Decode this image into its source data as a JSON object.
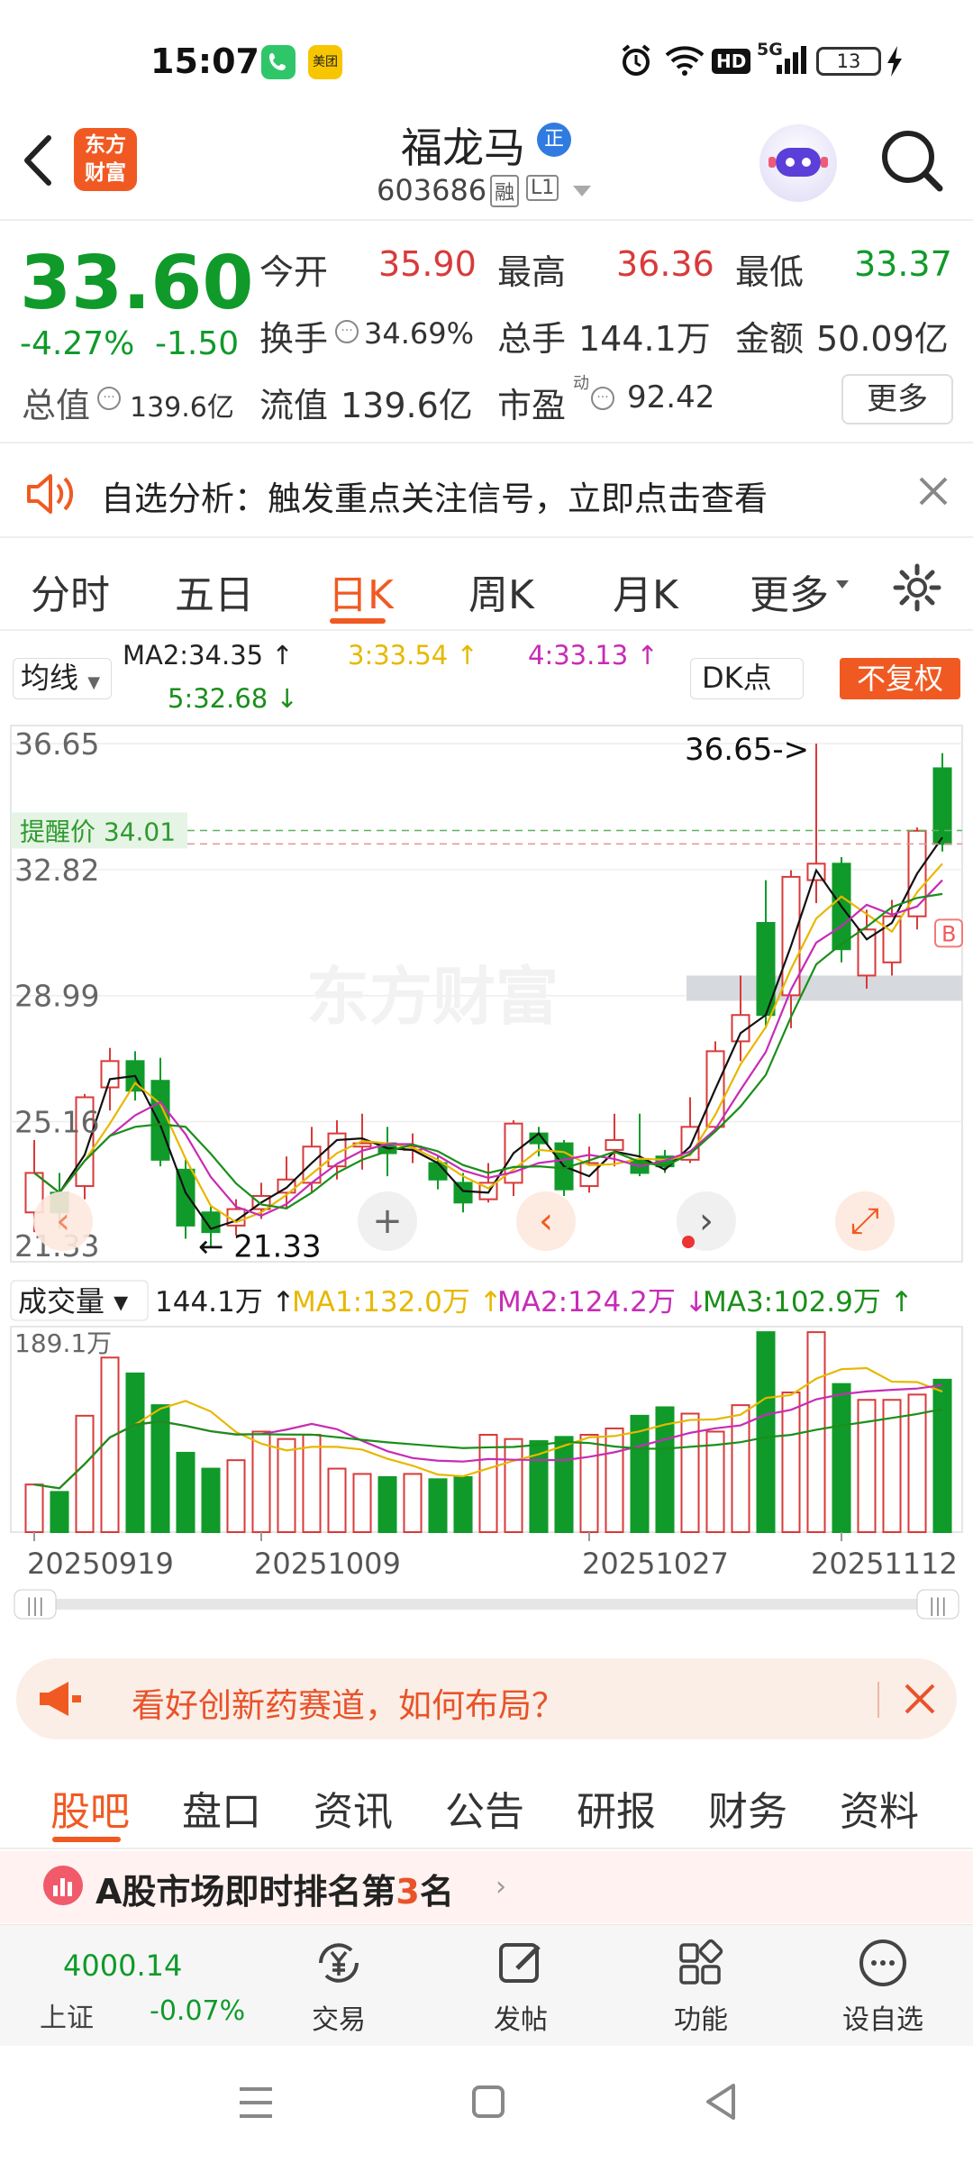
{
  "status_bar": {
    "time": "15:07",
    "app2_label": "美团",
    "network": "5G",
    "battery": "13",
    "hd": "HD"
  },
  "header": {
    "logo_line1": "东方",
    "logo_line2": "财富",
    "stock_name": "福龙马",
    "badge": "正",
    "code": "603686",
    "tag_margin": "融",
    "tag_level": "L1"
  },
  "quote": {
    "price": "33.60",
    "change_pct": "-4.27%",
    "change": "-1.50",
    "open_label": "今开",
    "open": "35.90",
    "high_label": "最高",
    "high": "36.36",
    "low_label": "最低",
    "low": "33.37",
    "turnover_label": "换手",
    "turnover": "34.69%",
    "volume_label": "总手",
    "volume": "144.1万",
    "amount_label": "金额",
    "amount": "50.09亿",
    "mktcap_label": "总值",
    "mktcap": "139.6亿",
    "float_label": "流值",
    "float": "139.6亿",
    "pe_label": "市盈",
    "pe_sup": "动",
    "pe": "92.42",
    "more_button": "更多"
  },
  "notice": {
    "text": "自选分析：触发重点关注信号，立即点击查看"
  },
  "chart_tabs": [
    "分时",
    "五日",
    "日K",
    "周K",
    "月K",
    "更多"
  ],
  "active_tab": "日K",
  "chart_controls": {
    "ma_select": "均线",
    "ma2": "MA2:34.35",
    "ma3": "3:33.54",
    "ma4": "4:33.13",
    "ma5": "5:32.68",
    "dk_button": "DK点",
    "adjust_button": "不复权",
    "alert_price": "提醒价 34.01",
    "high_marker": "36.65->",
    "low_marker": "21.33",
    "watermark": "东方财富",
    "b_marker": "B"
  },
  "chart_data": {
    "type": "candlestick",
    "y_ticks": [
      "36.65",
      "32.82",
      "28.99",
      "25.16",
      "21.33"
    ],
    "ylim": [
      21.33,
      36.65
    ],
    "x_labels": [
      "20250919",
      "20251009",
      "20251027",
      "20251112"
    ],
    "candles": [
      {
        "o": 22.4,
        "c": 23.6,
        "h": 24.6,
        "l": 21.8
      },
      {
        "o": 23.0,
        "c": 22.4,
        "h": 23.6,
        "l": 21.9
      },
      {
        "o": 23.2,
        "c": 25.9,
        "h": 26.0,
        "l": 22.8
      },
      {
        "o": 26.2,
        "c": 27.0,
        "h": 27.4,
        "l": 25.5
      },
      {
        "o": 27.0,
        "c": 26.1,
        "h": 27.3,
        "l": 25.8
      },
      {
        "o": 26.4,
        "c": 24.0,
        "h": 27.1,
        "l": 23.8
      },
      {
        "o": 23.7,
        "c": 22.0,
        "h": 24.0,
        "l": 21.6
      },
      {
        "o": 22.4,
        "c": 21.8,
        "h": 22.6,
        "l": 21.33
      },
      {
        "o": 22.0,
        "c": 22.5,
        "h": 22.8,
        "l": 21.7
      },
      {
        "o": 22.5,
        "c": 22.9,
        "h": 23.3,
        "l": 22.2
      },
      {
        "o": 23.0,
        "c": 23.4,
        "h": 24.1,
        "l": 22.5
      },
      {
        "o": 23.3,
        "c": 24.4,
        "h": 25.0,
        "l": 23.0
      },
      {
        "o": 23.8,
        "c": 24.8,
        "h": 25.2,
        "l": 23.4
      },
      {
        "o": 24.4,
        "c": 24.5,
        "h": 25.4,
        "l": 23.7
      },
      {
        "o": 24.5,
        "c": 24.2,
        "h": 25.0,
        "l": 23.5
      },
      {
        "o": 24.3,
        "c": 24.4,
        "h": 24.8,
        "l": 23.9
      },
      {
        "o": 23.9,
        "c": 23.4,
        "h": 24.1,
        "l": 23.1
      },
      {
        "o": 23.3,
        "c": 22.7,
        "h": 23.6,
        "l": 22.4
      },
      {
        "o": 22.8,
        "c": 23.3,
        "h": 23.9,
        "l": 22.7
      },
      {
        "o": 23.3,
        "c": 25.1,
        "h": 25.2,
        "l": 22.9
      },
      {
        "o": 24.8,
        "c": 24.5,
        "h": 25.0,
        "l": 24.1
      },
      {
        "o": 24.5,
        "c": 23.1,
        "h": 24.6,
        "l": 22.9
      },
      {
        "o": 23.2,
        "c": 23.9,
        "h": 24.4,
        "l": 23.0
      },
      {
        "o": 24.3,
        "c": 24.6,
        "h": 25.4,
        "l": 23.8
      },
      {
        "o": 24.0,
        "c": 23.6,
        "h": 25.4,
        "l": 23.5
      },
      {
        "o": 24.1,
        "c": 23.8,
        "h": 24.3,
        "l": 23.6
      },
      {
        "o": 24.0,
        "c": 25.0,
        "h": 25.9,
        "l": 23.9
      },
      {
        "o": 25.0,
        "c": 27.3,
        "h": 27.6,
        "l": 24.9
      },
      {
        "o": 27.6,
        "c": 28.4,
        "h": 29.6,
        "l": 27.0
      },
      {
        "o": 31.2,
        "c": 28.4,
        "h": 32.5,
        "l": 28.0
      },
      {
        "o": 29.0,
        "c": 32.6,
        "h": 32.8,
        "l": 28.0
      },
      {
        "o": 32.5,
        "c": 33.0,
        "h": 36.65,
        "l": 31.8
      },
      {
        "o": 33.0,
        "c": 30.4,
        "h": 33.2,
        "l": 30.0
      },
      {
        "o": 29.6,
        "c": 31.0,
        "h": 31.6,
        "l": 29.2
      },
      {
        "o": 30.0,
        "c": 31.4,
        "h": 31.9,
        "l": 29.6
      },
      {
        "o": 31.4,
        "c": 34.0,
        "h": 34.1,
        "l": 31.0
      },
      {
        "o": 35.9,
        "c": 33.6,
        "h": 36.36,
        "l": 33.37
      }
    ],
    "volume_ticks": [
      "189.1万"
    ],
    "volume": [
      45,
      38,
      110,
      165,
      150,
      120,
      75,
      60,
      68,
      95,
      88,
      92,
      60,
      55,
      52,
      55,
      50,
      52,
      92,
      88,
      86,
      90,
      92,
      98,
      110,
      118,
      112,
      95,
      120,
      189,
      132,
      189,
      140,
      125,
      125,
      130,
      144.1
    ]
  },
  "volume_controls": {
    "select": "成交量",
    "vol": "144.1万",
    "ma1": "MA1:132.0万",
    "ma2": "MA2:124.2万",
    "ma3": "MA3:102.9万",
    "scale": "189.1万"
  },
  "banner": {
    "text": "看好创新药赛道，如何布局？"
  },
  "sub_tabs": [
    "股吧",
    "盘口",
    "资讯",
    "公告",
    "研报",
    "财务",
    "资料"
  ],
  "active_sub_tab": "股吧",
  "rank": {
    "prefix": "A股市场即时排名第",
    "num": "3",
    "suffix": "名"
  },
  "bottom": {
    "index_value": "4000.14",
    "index_name": "上证",
    "index_change": "-0.07%",
    "trade": "交易",
    "post": "发帖",
    "func": "功能",
    "watch": "设自选"
  },
  "colors": {
    "up": "#d93a3a",
    "down": "#109a2a",
    "ma_orange": "#e7b800",
    "ma_purple": "#c72cb5",
    "ma_green": "#1a8f1a",
    "brand": "#f05a22"
  }
}
